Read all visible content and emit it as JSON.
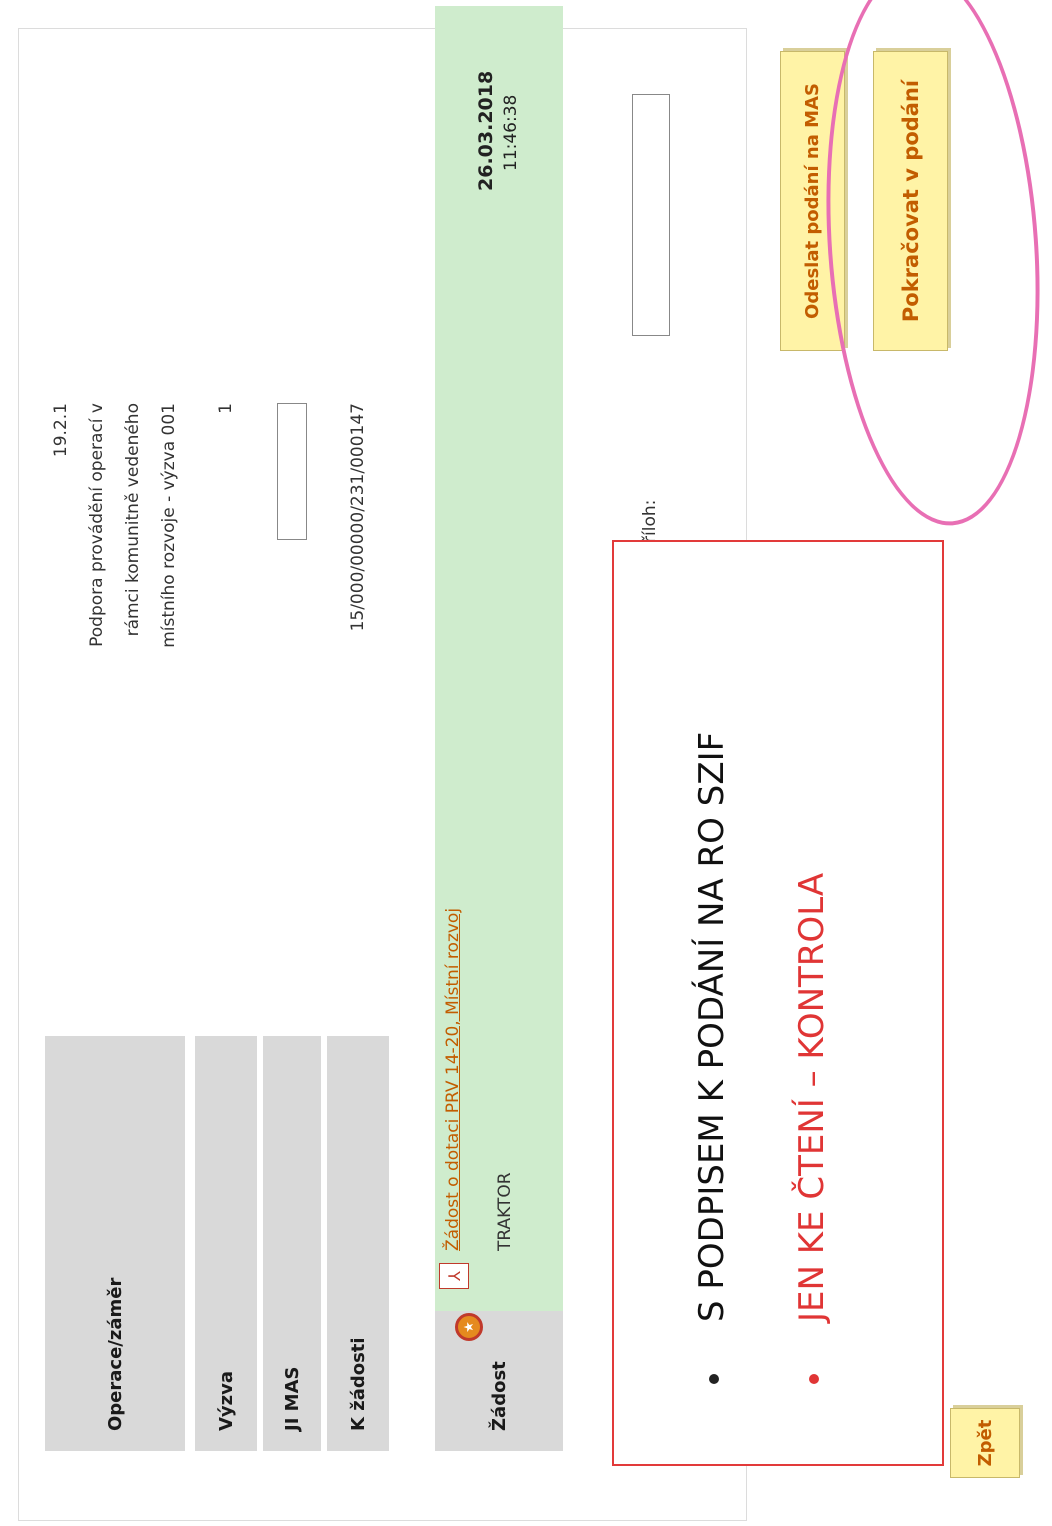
{
  "form": {
    "rows": [
      {
        "label": "Operace/záměr",
        "value_code": "19.2.1",
        "value_lines": [
          "Podpora provádění operací v",
          "rámci komunitně vedeného",
          "místního rozvoje - výzva 001"
        ]
      },
      {
        "label": "Výzva",
        "value": "1"
      },
      {
        "label": "JI MAS",
        "value": ""
      },
      {
        "label": "K žádosti",
        "value": "15/000/00000/231/000147"
      }
    ]
  },
  "document": {
    "label": "Žádost",
    "link_text": "Žádost o dotaci PRV 14-20, Místní rozvoj",
    "name": "TRAKTOR",
    "date": "26.03.2018",
    "time": "11:46:38",
    "badge_icon": "certificate-badge-icon",
    "pdf_icon": "pdf-icon"
  },
  "attachments": {
    "label": "dat v typech příloh:"
  },
  "note": {
    "line1": "S PODPISEM K PODÁNÍ NA RO SZIF",
    "line2": "JEN KE ČTENÍ – KONTROLA"
  },
  "buttons": {
    "back": "Zpět",
    "send": "Odeslat podání na MAS",
    "continue": "Pokračovat v podání"
  },
  "colors": {
    "accent_blue": "#27a3e0",
    "green_row": "#cfeccd",
    "button_bg": "#fff3a6",
    "button_text": "#c25d00",
    "note_red": "#e23a3a",
    "highlight_pink": "#e86fb4"
  }
}
